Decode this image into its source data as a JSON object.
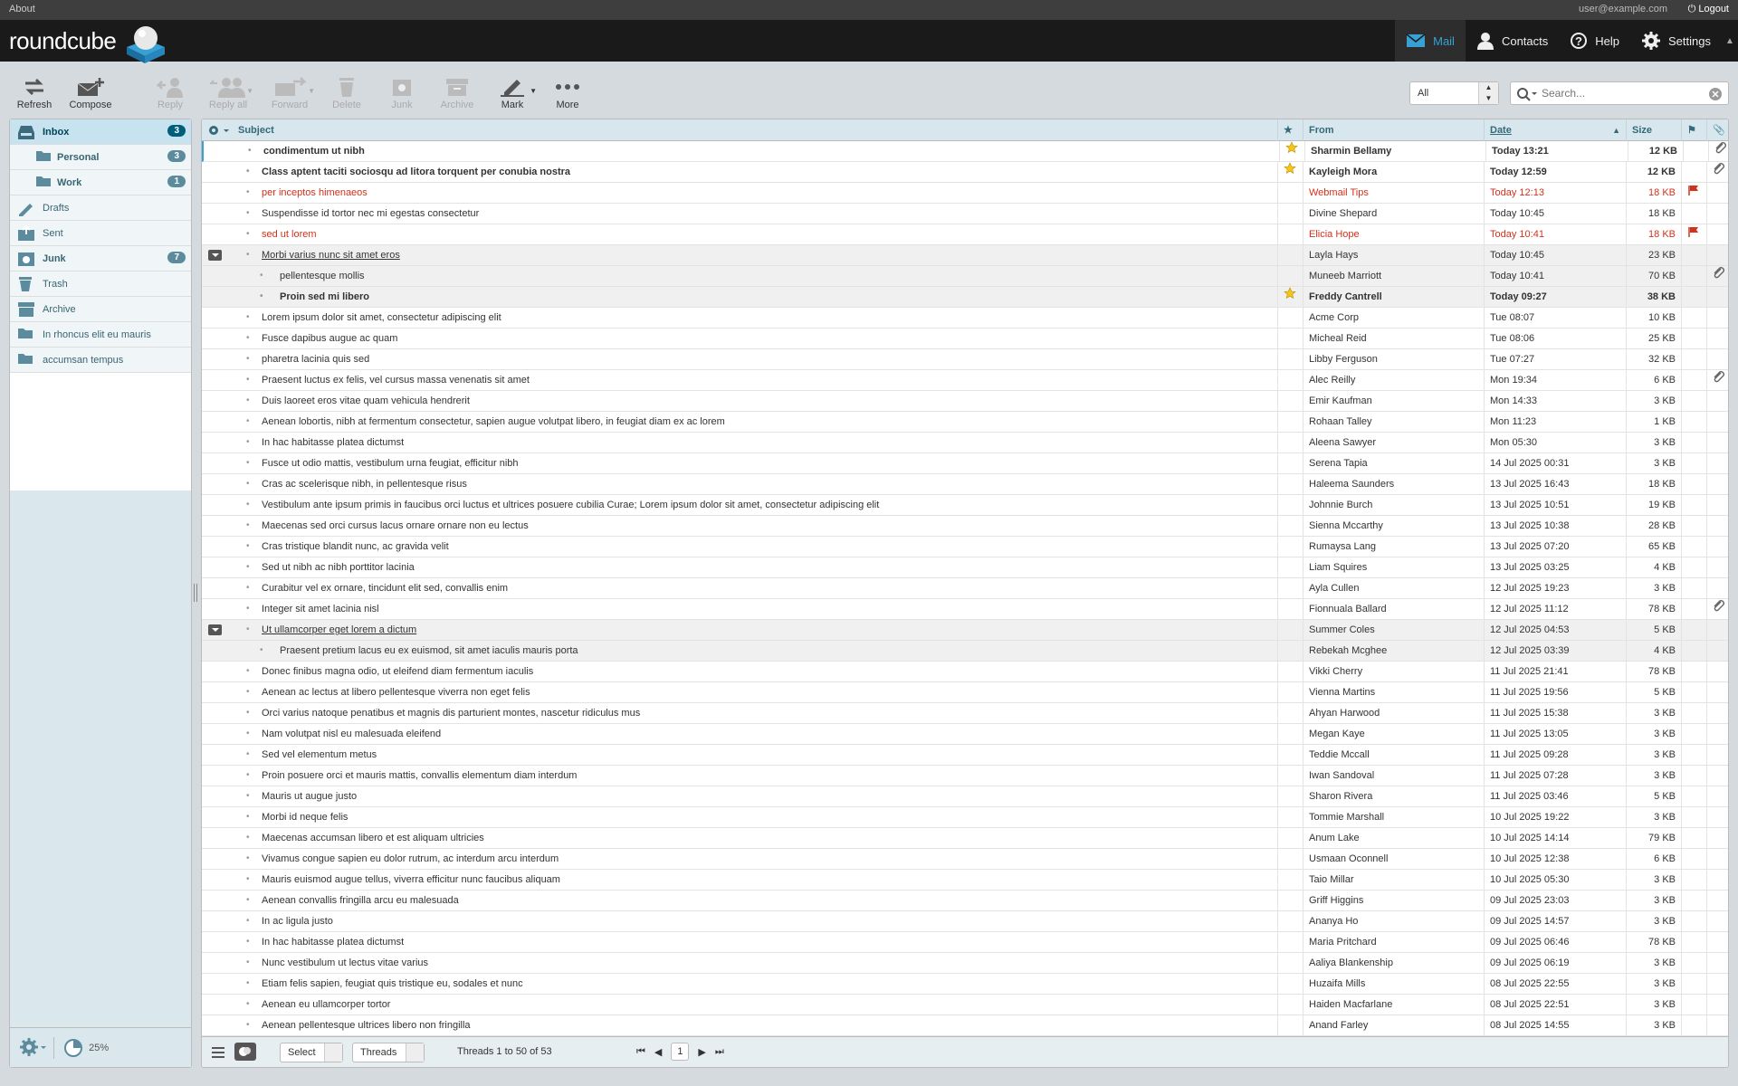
{
  "topline": {
    "about": "About",
    "user": "user@example.com",
    "logout": "Logout"
  },
  "app": {
    "logo": "roundcube"
  },
  "taskbar": [
    {
      "label": "Mail",
      "icon": "mail-icon",
      "active": true
    },
    {
      "label": "Contacts",
      "icon": "contacts-icon"
    },
    {
      "label": "Help",
      "icon": "help-icon"
    },
    {
      "label": "Settings",
      "icon": "gear-icon"
    }
  ],
  "toolbar": {
    "refresh": "Refresh",
    "compose": "Compose",
    "reply": "Reply",
    "reply_all": "Reply all",
    "forward": "Forward",
    "delete": "Delete",
    "junk": "Junk",
    "archive": "Archive",
    "mark": "Mark",
    "more": "More"
  },
  "filter": {
    "value": "All"
  },
  "search": {
    "placeholder": "Search..."
  },
  "folders": [
    {
      "label": "Inbox",
      "badge": "3",
      "icon": "inbox-icon",
      "selected": true
    },
    {
      "label": "Personal",
      "badge": "3",
      "icon": "folder-icon",
      "sub": true
    },
    {
      "label": "Work",
      "badge": "1",
      "icon": "folder-icon",
      "sub": true
    },
    {
      "label": "Drafts",
      "icon": "drafts-icon"
    },
    {
      "label": "Sent",
      "icon": "sent-icon"
    },
    {
      "label": "Junk",
      "badge": "7",
      "icon": "junk-icon"
    },
    {
      "label": "Trash",
      "icon": "trash-icon"
    },
    {
      "label": "Archive",
      "icon": "archive-icon"
    },
    {
      "label": "In rhoncus elit eu mauris",
      "icon": "folder-icon"
    },
    {
      "label": "accumsan tempus",
      "icon": "folder-icon"
    }
  ],
  "quota": "25%",
  "columns": {
    "subject": "Subject",
    "from": "From",
    "date": "Date",
    "size": "Size"
  },
  "messages": [
    {
      "subject": "condimentum ut nibh",
      "from": "Sharmin Bellamy",
      "date": "Today 13:21",
      "size": "12 KB",
      "unread": true,
      "star": true,
      "att": true,
      "first": true
    },
    {
      "subject": "Class aptent taciti sociosqu ad litora torquent per conubia nostra",
      "from": "Kayleigh Mora",
      "date": "Today 12:59",
      "size": "12 KB",
      "unread": true,
      "star": true,
      "att": true
    },
    {
      "subject": "per inceptos himenaeos",
      "from": "Webmail Tips",
      "date": "Today 12:13",
      "size": "18 KB",
      "flagged": true
    },
    {
      "subject": "Suspendisse id tortor nec mi egestas consectetur",
      "from": "Divine Shepard",
      "date": "Today 10:45",
      "size": "18 KB"
    },
    {
      "subject": "sed ut lorem",
      "from": "Elicia Hope",
      "date": "Today 10:41",
      "size": "18 KB",
      "flagged": true
    },
    {
      "subject": "Morbi varius nunc sit amet eros",
      "from": "Layla Hays",
      "date": "Today 10:45",
      "size": "23 KB",
      "thread": true
    },
    {
      "subject": "pellentesque mollis",
      "from": "Muneeb Marriott",
      "date": "Today 10:41",
      "size": "70 KB",
      "child": true,
      "att": true
    },
    {
      "subject": "Proin sed mi libero",
      "from": "Freddy Cantrell",
      "date": "Today 09:27",
      "size": "38 KB",
      "child": true,
      "unread": true,
      "star": true
    },
    {
      "subject": "Lorem ipsum dolor sit amet, consectetur adipiscing elit",
      "from": "Acme Corp",
      "date": "Tue 08:07",
      "size": "10 KB"
    },
    {
      "subject": "Fusce dapibus augue ac quam",
      "from": "Micheal Reid",
      "date": "Tue 08:06",
      "size": "25 KB"
    },
    {
      "subject": "pharetra lacinia quis sed",
      "from": "Libby Ferguson",
      "date": "Tue 07:27",
      "size": "32 KB"
    },
    {
      "subject": "Praesent luctus ex felis, vel cursus massa venenatis sit amet",
      "from": "Alec Reilly",
      "date": "Mon 19:34",
      "size": "6 KB",
      "att": true
    },
    {
      "subject": "Duis laoreet eros vitae quam vehicula hendrerit",
      "from": "Emir Kaufman",
      "date": "Mon 14:33",
      "size": "3 KB"
    },
    {
      "subject": "Aenean lobortis, nibh at fermentum consectetur, sapien augue volutpat libero, in feugiat diam ex ac lorem",
      "from": "Rohaan Talley",
      "date": "Mon 11:23",
      "size": "1 KB"
    },
    {
      "subject": "In hac habitasse platea dictumst",
      "from": "Aleena Sawyer",
      "date": "Mon 05:30",
      "size": "3 KB"
    },
    {
      "subject": "Fusce ut odio mattis, vestibulum urna feugiat, efficitur nibh",
      "from": "Serena Tapia",
      "date": "14 Jul 2025 00:31",
      "size": "3 KB"
    },
    {
      "subject": "Cras ac scelerisque nibh, in pellentesque risus",
      "from": "Haleema Saunders",
      "date": "13 Jul 2025 16:43",
      "size": "18 KB"
    },
    {
      "subject": "Vestibulum ante ipsum primis in faucibus orci luctus et ultrices posuere cubilia Curae; Lorem ipsum dolor sit amet, consectetur adipiscing elit",
      "from": "Johnnie Burch",
      "date": "13 Jul 2025 10:51",
      "size": "19 KB"
    },
    {
      "subject": "Maecenas sed orci cursus lacus ornare ornare non eu lectus",
      "from": "Sienna Mccarthy",
      "date": "13 Jul 2025 10:38",
      "size": "28 KB"
    },
    {
      "subject": "Cras tristique blandit nunc, ac gravida velit",
      "from": "Rumaysa Lang",
      "date": "13 Jul 2025 07:20",
      "size": "65 KB"
    },
    {
      "subject": "Sed ut nibh ac nibh porttitor lacinia",
      "from": "Liam Squires",
      "date": "13 Jul 2025 03:25",
      "size": "4 KB"
    },
    {
      "subject": "Curabitur vel ex ornare, tincidunt elit sed, convallis enim",
      "from": "Ayla Cullen",
      "date": "12 Jul 2025 19:23",
      "size": "3 KB"
    },
    {
      "subject": "Integer sit amet lacinia nisl",
      "from": "Fionnuala Ballard",
      "date": "12 Jul 2025 11:12",
      "size": "78 KB",
      "att": true
    },
    {
      "subject": "Ut ullamcorper eget lorem a dictum",
      "from": "Summer Coles",
      "date": "12 Jul 2025 04:53",
      "size": "5 KB",
      "thread": true
    },
    {
      "subject": "Praesent pretium lacus eu ex euismod, sit amet iaculis mauris porta",
      "from": "Rebekah Mcghee",
      "date": "12 Jul 2025 03:39",
      "size": "4 KB",
      "child": true
    },
    {
      "subject": "Donec finibus magna odio, ut eleifend diam fermentum iaculis",
      "from": "Vikki Cherry",
      "date": "11 Jul 2025 21:41",
      "size": "78 KB"
    },
    {
      "subject": "Aenean ac lectus at libero pellentesque viverra non eget felis",
      "from": "Vienna Martins",
      "date": "11 Jul 2025 19:56",
      "size": "5 KB"
    },
    {
      "subject": "Orci varius natoque penatibus et magnis dis parturient montes, nascetur ridiculus mus",
      "from": "Ahyan Harwood",
      "date": "11 Jul 2025 15:38",
      "size": "3 KB"
    },
    {
      "subject": "Nam volutpat nisl eu malesuada eleifend",
      "from": "Megan Kaye",
      "date": "11 Jul 2025 13:05",
      "size": "3 KB"
    },
    {
      "subject": "Sed vel elementum metus",
      "from": "Teddie Mccall",
      "date": "11 Jul 2025 09:28",
      "size": "3 KB"
    },
    {
      "subject": "Proin posuere orci et mauris mattis, convallis elementum diam interdum",
      "from": "Iwan Sandoval",
      "date": "11 Jul 2025 07:28",
      "size": "3 KB"
    },
    {
      "subject": "Mauris ut augue justo",
      "from": "Sharon Rivera",
      "date": "11 Jul 2025 03:46",
      "size": "5 KB"
    },
    {
      "subject": "Morbi id neque felis",
      "from": "Tommie Marshall",
      "date": "10 Jul 2025 19:22",
      "size": "3 KB"
    },
    {
      "subject": "Maecenas accumsan libero et est aliquam ultricies",
      "from": "Anum Lake",
      "date": "10 Jul 2025 14:14",
      "size": "79 KB"
    },
    {
      "subject": "Vivamus congue sapien eu dolor rutrum, ac interdum arcu interdum",
      "from": "Usmaan Oconnell",
      "date": "10 Jul 2025 12:38",
      "size": "6 KB"
    },
    {
      "subject": "Mauris euismod augue tellus, viverra efficitur nunc faucibus aliquam",
      "from": "Taio Millar",
      "date": "10 Jul 2025 05:30",
      "size": "3 KB"
    },
    {
      "subject": "Aenean convallis fringilla arcu eu malesuada",
      "from": "Griff Higgins",
      "date": "09 Jul 2025 23:03",
      "size": "3 KB"
    },
    {
      "subject": "In ac ligula justo",
      "from": "Ananya Ho",
      "date": "09 Jul 2025 14:57",
      "size": "3 KB"
    },
    {
      "subject": "In hac habitasse platea dictumst",
      "from": "Maria Pritchard",
      "date": "09 Jul 2025 06:46",
      "size": "78 KB"
    },
    {
      "subject": "Nunc vestibulum ut lectus vitae varius",
      "from": "Aaliya Blankenship",
      "date": "09 Jul 2025 06:19",
      "size": "3 KB"
    },
    {
      "subject": "Etiam felis sapien, feugiat quis tristique eu, sodales et nunc",
      "from": "Huzaifa Mills",
      "date": "08 Jul 2025 22:55",
      "size": "3 KB"
    },
    {
      "subject": "Aenean eu ullamcorper tortor",
      "from": "Haiden Macfarlane",
      "date": "08 Jul 2025 22:51",
      "size": "3 KB"
    },
    {
      "subject": "Aenean pellentesque ultrices libero non fringilla",
      "from": "Anand Farley",
      "date": "08 Jul 2025 14:55",
      "size": "3 KB"
    }
  ],
  "footer": {
    "select": "Select",
    "threads": "Threads",
    "count": "Threads 1 to 50 of 53",
    "page": "1"
  },
  "colors": {
    "accent": "#37a1d3",
    "flagged": "#d1321c",
    "star": "#f5c518"
  }
}
